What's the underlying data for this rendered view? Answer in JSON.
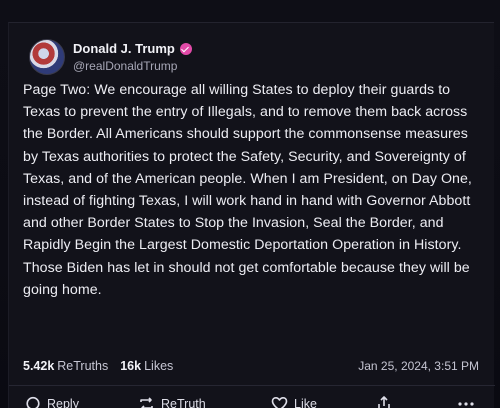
{
  "post": {
    "author": {
      "display_name": "Donald J. Trump",
      "handle": "@realDonaldTrump",
      "verified_color": "#e24aa8"
    },
    "body": "Page Two: We encourage all willing States to deploy their guards to Texas to prevent the entry of Illegals, and to remove them back across the Border. All Americans should support the commonsense measures by Texas authorities to protect the Safety, Security, and Sovereignty of Texas, and of the American people. When I am President, on Day One, instead of fighting Texas, I will work hand in hand with Governor Abbott and other Border States to Stop the Invasion, Seal the Border, and Rapidly Begin the Largest Domestic Deportation Operation in History. Those Biden has let in should not get comfortable because they will be going home.",
    "stats": {
      "retruths_value": "5.42k",
      "retruths_label": "ReTruths",
      "likes_value": "16k",
      "likes_label": "Likes"
    },
    "timestamp": "Jan 25, 2024, 3:51 PM"
  },
  "actions": {
    "reply_label": "Reply",
    "retruth_label": "ReTruth",
    "like_label": "Like",
    "icons": [
      "reply-icon",
      "retruth-icon",
      "like-icon",
      "share-icon",
      "more-icon"
    ]
  }
}
